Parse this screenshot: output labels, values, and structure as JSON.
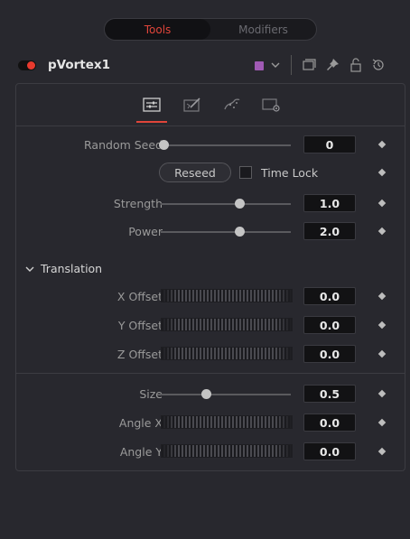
{
  "top_tabs": [
    {
      "label": "Tools",
      "active": true
    },
    {
      "label": "Modifiers",
      "active": false
    }
  ],
  "tool": {
    "name": "pVortex1",
    "enabled": true,
    "color": "#a05ab4"
  },
  "header_icons": [
    "swatch-dropdown-icon",
    "panel-icon",
    "pin-icon",
    "lock-icon",
    "reset-icon"
  ],
  "subtabs": [
    {
      "icon": "controls-icon",
      "active": true
    },
    {
      "icon": "set-icon",
      "active": false
    },
    {
      "icon": "region-icon",
      "active": false
    },
    {
      "icon": "settings-icon",
      "active": false
    }
  ],
  "random_seed": {
    "label": "Random Seed",
    "value": "0"
  },
  "reseed": {
    "label": "Reseed"
  },
  "time_lock": {
    "label": "Time Lock",
    "checked": false
  },
  "strength": {
    "label": "Strength",
    "value": "1.0"
  },
  "power": {
    "label": "Power",
    "value": "2.0"
  },
  "translation": {
    "title": "Translation",
    "expanded": true,
    "x_offset": {
      "label": "X Offset",
      "value": "0.0"
    },
    "y_offset": {
      "label": "Y Offset",
      "value": "0.0"
    },
    "z_offset": {
      "label": "Z Offset",
      "value": "0.0"
    }
  },
  "size": {
    "label": "Size",
    "value": "0.5"
  },
  "angle_x": {
    "label": "Angle X",
    "value": "0.0"
  },
  "angle_y": {
    "label": "Angle Y",
    "value": "0.0"
  },
  "colors": {
    "accent": "#e0453a",
    "background": "#28282e",
    "field": "#121214"
  }
}
